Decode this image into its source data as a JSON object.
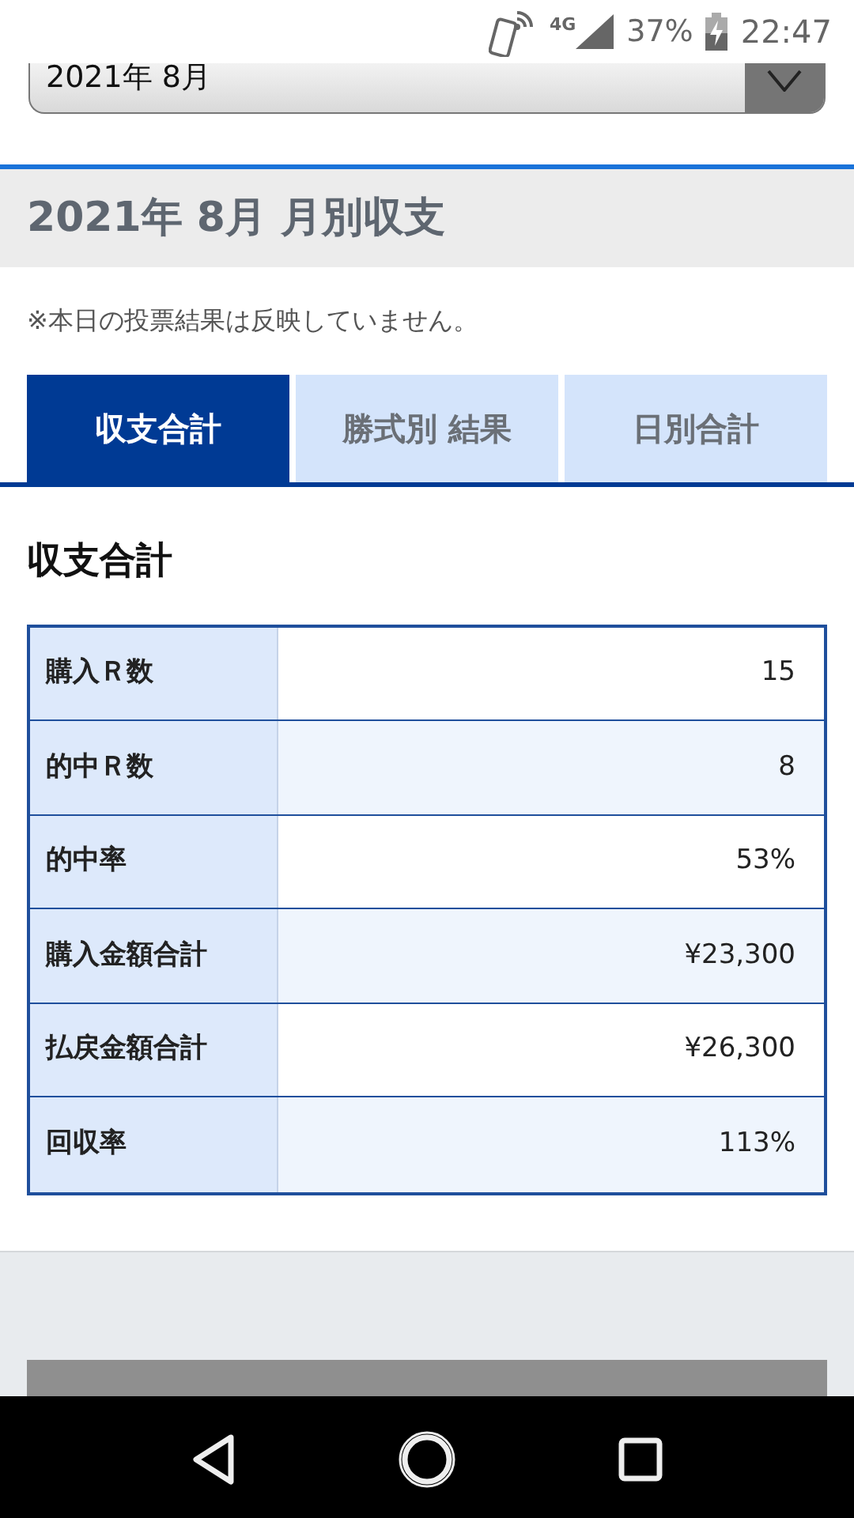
{
  "status_bar": {
    "network": "4G",
    "battery": "37%",
    "time": "22:47"
  },
  "month_select": {
    "value": "2021年 8月"
  },
  "header": {
    "title": "2021年 8月 月別収支"
  },
  "note": "※本日の投票結果は反映していません。",
  "tabs": [
    {
      "label": "収支合計",
      "selected": true
    },
    {
      "label": "勝式別 結果",
      "selected": false
    },
    {
      "label": "日別合計",
      "selected": false
    }
  ],
  "section_title": "収支合計",
  "table": {
    "rows": [
      {
        "label": "購入Ｒ数",
        "value": "15"
      },
      {
        "label": "的中Ｒ数",
        "value": "8"
      },
      {
        "label": "的中率",
        "value": "53%"
      },
      {
        "label": "購入金額合計",
        "value": "¥23,300"
      },
      {
        "label": "払戻金額合計",
        "value": "¥26,300"
      },
      {
        "label": "回収率",
        "value": "113%"
      }
    ]
  }
}
